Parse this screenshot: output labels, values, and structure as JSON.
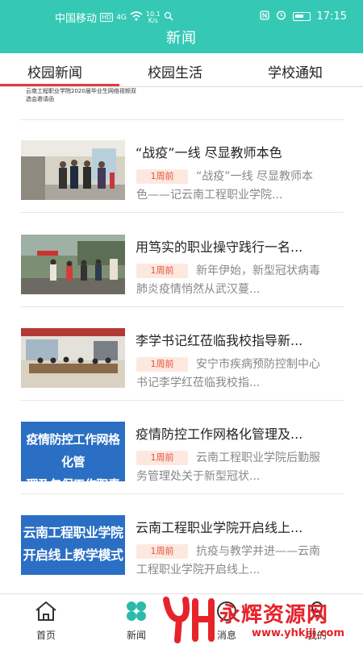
{
  "status_bar": {
    "carrier": "中国移动",
    "hd": "HD",
    "network": "4G",
    "speed_value": "10.1",
    "speed_unit": "K/s",
    "time": "17:15"
  },
  "header": {
    "title": "新闻"
  },
  "tabs": [
    {
      "label": "校园新闻",
      "active": true
    },
    {
      "label": "校园生活",
      "active": false
    },
    {
      "label": "学校通知",
      "active": false
    }
  ],
  "partial_item": {
    "text": "云南工程职业学院2020届毕业生网络视频双选会邀请函"
  },
  "news": [
    {
      "title": "“战疫”一线 尽显教师本色",
      "time": "1周前",
      "summary": "“战疫”一线 尽显教师本色——记云南工程职业学院..."
    },
    {
      "title": "用笃实的职业操守践行一名...",
      "time": "1周前",
      "summary": "新年伊始，新型冠状病毒肺炎疫情悄然从武汉蔓..."
    },
    {
      "title": "李学书记红莅临我校指导新...",
      "time": "1周前",
      "summary": "安宁市疾病预防控制中心书记李学红莅临我校指..."
    },
    {
      "title": "疫情防控工作网格化管理及...",
      "time": "1周前",
      "summary": "云南工程职业学院后勤服务管理处关于新型冠状...",
      "banner_line1": "疫情防控工作网格化管",
      "banner_line2": "理及包保工作职责方案"
    },
    {
      "title": "云南工程职业学院开启线上...",
      "time": "1周前",
      "summary": "抗疫与教学并进——云南工程职业学院开启线上...",
      "banner_line1": "云南工程职业学院",
      "banner_line2": "开启线上教学模式"
    }
  ],
  "bottom_nav": [
    {
      "label": "首页",
      "icon": "home-icon"
    },
    {
      "label": "新闻",
      "icon": "clover-icon",
      "active": true
    },
    {
      "label": "消息",
      "icon": "message-icon"
    },
    {
      "label": "我的",
      "icon": "user-icon"
    }
  ],
  "watermark": {
    "text": "永辉资源网",
    "url": "www.yhkjjj.com"
  },
  "colors": {
    "accent": "#35c9b5",
    "tab_indicator": "#e43c3c",
    "badge_bg": "#fde8e0",
    "badge_text": "#e5543a",
    "banner": "#2a6fc4"
  }
}
